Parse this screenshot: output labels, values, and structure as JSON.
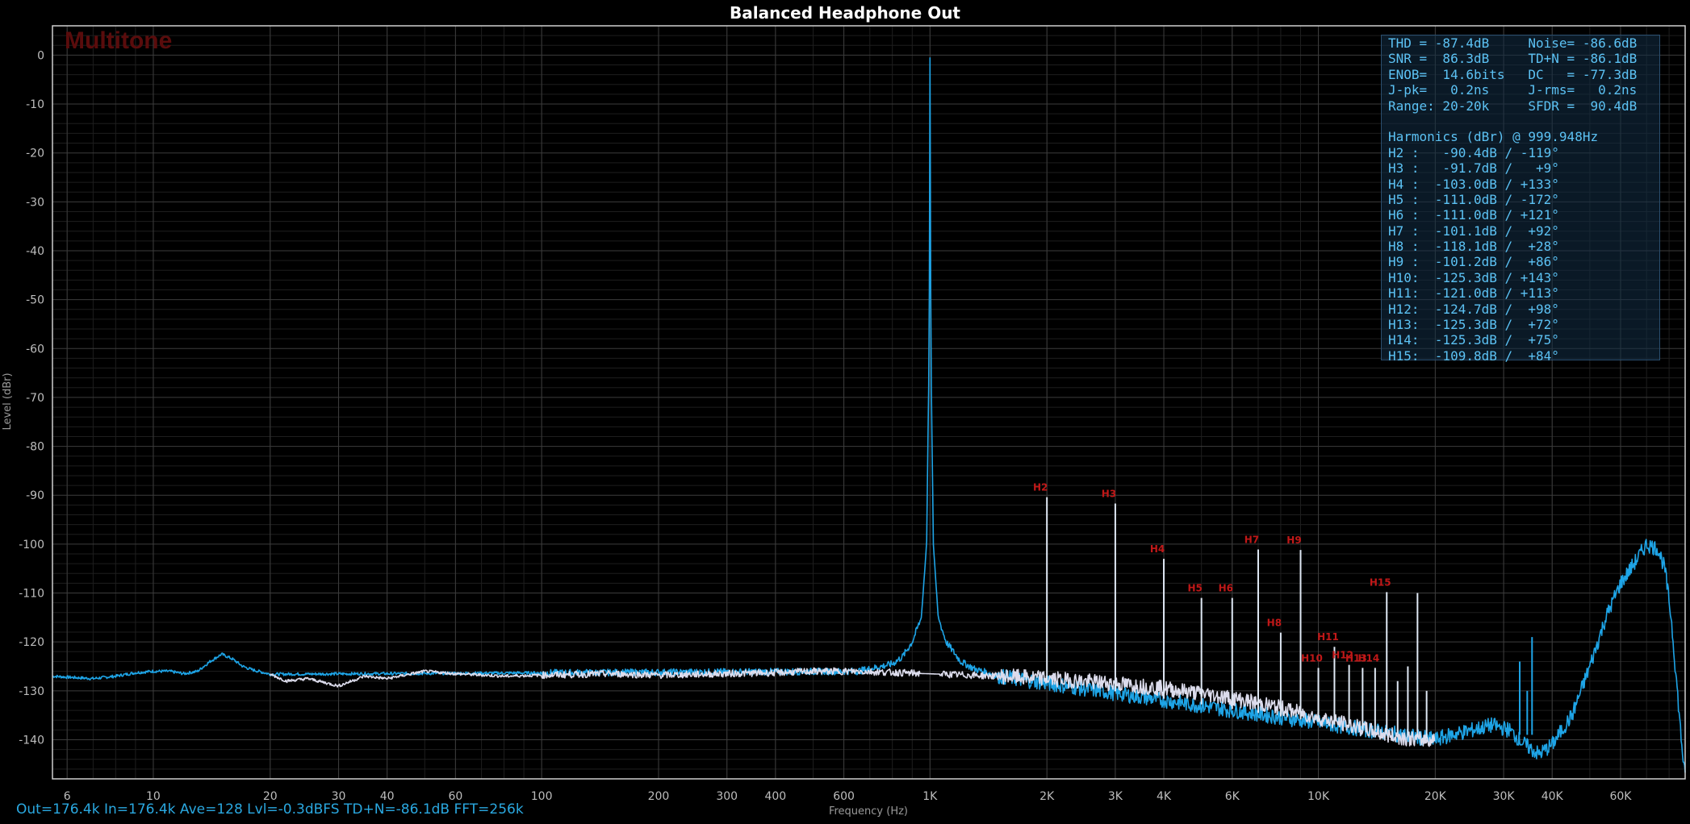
{
  "window": {
    "title": "Balanced Headphone Out"
  },
  "watermark": "Multitone",
  "footer": "Out=176.4k In=176.4k Ave=128 Lvl=-0.3dBFS TD+N=-86.1dB FFT=256k",
  "stats": {
    "summary": [
      "THD = -87.4dB     Noise= -86.6dB",
      "SNR =  86.3dB     TD+N = -86.1dB",
      "ENOB=  14.6bits   DC   = -77.3dB",
      "J-pk=   0.2ns     J-rms=   0.2ns",
      "Range: 20-20k     SFDR =  90.4dB"
    ],
    "harmonics_header": "Harmonics (dBr) @ 999.948Hz",
    "harmonics": [
      "H2 :   -90.4dB / -119°",
      "H3 :   -91.7dB /   +9°",
      "H4 :  -103.0dB / +133°",
      "H5 :  -111.0dB / -172°",
      "H6 :  -111.0dB / +121°",
      "H7 :  -101.1dB /  +92°",
      "H8 :  -118.1dB /  +28°",
      "H9 :  -101.2dB /  +86°",
      "H10:  -125.3dB / +143°",
      "H11:  -121.0dB / +113°",
      "H12:  -124.7dB /  +98°",
      "H13:  -125.3dB /  +72°",
      "H14:  -125.3dB /  +75°",
      "H15:  -109.8dB /  +84°"
    ]
  },
  "colors": {
    "background": "#000000",
    "grid": "#3c3c3c",
    "grid_minor": "#1e1e1e",
    "plot_border": "#cfcfcf",
    "spectrum_fundamental": "#1ea4e6",
    "spectrum_residual": "#dcdcec",
    "harmonic_label": "#c01818",
    "stats_text": "#5cc2f4",
    "footer_text": "#2aa8e0"
  },
  "chart_data": {
    "type": "line",
    "title": "Balanced Headphone Out",
    "xlabel": "Frequency (Hz)",
    "ylabel": "Level (dBr)",
    "xscale": "log",
    "xlim": [
      5.5,
      88000
    ],
    "ylim": [
      -148,
      6
    ],
    "grid": true,
    "x_ticks": [
      {
        "v": 6,
        "label": "6"
      },
      {
        "v": 10,
        "label": "10"
      },
      {
        "v": 20,
        "label": "20"
      },
      {
        "v": 30,
        "label": "30"
      },
      {
        "v": 40,
        "label": "40"
      },
      {
        "v": 60,
        "label": "60"
      },
      {
        "v": 100,
        "label": "100"
      },
      {
        "v": 200,
        "label": "200"
      },
      {
        "v": 300,
        "label": "300"
      },
      {
        "v": 400,
        "label": "400"
      },
      {
        "v": 600,
        "label": "600"
      },
      {
        "v": 1000,
        "label": "1K"
      },
      {
        "v": 2000,
        "label": "2K"
      },
      {
        "v": 3000,
        "label": "3K"
      },
      {
        "v": 4000,
        "label": "4K"
      },
      {
        "v": 6000,
        "label": "6K"
      },
      {
        "v": 10000,
        "label": "10K"
      },
      {
        "v": 20000,
        "label": "20K"
      },
      {
        "v": 30000,
        "label": "30K"
      },
      {
        "v": 40000,
        "label": "40K"
      },
      {
        "v": 60000,
        "label": "60K"
      }
    ],
    "y_ticks": [
      0,
      -10,
      -20,
      -30,
      -40,
      -50,
      -60,
      -70,
      -80,
      -90,
      -100,
      -110,
      -120,
      -130,
      -140
    ],
    "series": [
      {
        "color": "#1ea4e6",
        "points": [
          [
            5.5,
            -127
          ],
          [
            6,
            -127.2
          ],
          [
            7,
            -127.5
          ],
          [
            8,
            -127
          ],
          [
            9,
            -126.3
          ],
          [
            10,
            -126
          ],
          [
            11,
            -126
          ],
          [
            12,
            -126.5
          ],
          [
            13,
            -126
          ],
          [
            14,
            -124
          ],
          [
            15,
            -122.5
          ],
          [
            16,
            -123.5
          ],
          [
            17,
            -125
          ],
          [
            18,
            -125.7
          ],
          [
            20,
            -126.6
          ],
          [
            650,
            -126
          ],
          [
            700,
            -125.5
          ],
          [
            750,
            -125
          ],
          [
            800,
            -124.5
          ],
          [
            850,
            -123
          ],
          [
            900,
            -120
          ],
          [
            950,
            -115
          ],
          [
            980,
            -100
          ],
          [
            995,
            -60
          ],
          [
            1000,
            -0.3
          ],
          [
            1005,
            -60
          ],
          [
            1020,
            -100
          ],
          [
            1050,
            -115
          ],
          [
            1100,
            -120
          ],
          [
            1200,
            -124
          ],
          [
            1300,
            -125.5
          ],
          [
            1500,
            -127
          ],
          [
            20000,
            -140
          ],
          [
            22000,
            -139
          ],
          [
            25000,
            -138
          ],
          [
            28000,
            -137
          ],
          [
            31000,
            -138
          ],
          [
            34000,
            -141
          ],
          [
            37000,
            -143
          ],
          [
            40000,
            -141
          ],
          [
            45000,
            -135
          ],
          [
            50000,
            -125
          ],
          [
            55000,
            -115
          ],
          [
            60000,
            -108
          ],
          [
            65000,
            -104
          ],
          [
            70000,
            -100
          ],
          [
            75000,
            -101
          ],
          [
            78000,
            -105
          ],
          [
            81000,
            -115
          ],
          [
            84000,
            -130
          ],
          [
            86000,
            -140
          ],
          [
            88000,
            -148
          ]
        ]
      },
      {
        "color": "#dcdcec",
        "points": [
          [
            20,
            -126.6
          ],
          [
            22,
            -128
          ],
          [
            25,
            -127.5
          ],
          [
            30,
            -129
          ],
          [
            35,
            -127
          ],
          [
            40,
            -127.5
          ],
          [
            50,
            -126
          ],
          [
            60,
            -126.5
          ],
          [
            80,
            -127
          ],
          [
            100,
            -126.8
          ],
          [
            150,
            -126.5
          ],
          [
            200,
            -126.8
          ],
          [
            300,
            -126.5
          ],
          [
            400,
            -126.3
          ],
          [
            500,
            -126
          ],
          [
            650,
            -126
          ],
          [
            1500,
            -127
          ],
          [
            2000,
            -127.5
          ],
          [
            3000,
            -128.5
          ],
          [
            4000,
            -129.5
          ],
          [
            5000,
            -130.5
          ],
          [
            6000,
            -131.5
          ],
          [
            8000,
            -133.5
          ],
          [
            10000,
            -135.5
          ],
          [
            12000,
            -137
          ],
          [
            15000,
            -139
          ],
          [
            18000,
            -140
          ],
          [
            20000,
            -140
          ]
        ]
      }
    ],
    "harmonics": [
      {
        "label": "H2",
        "freq": 2000,
        "level": -90.4
      },
      {
        "label": "H3",
        "freq": 3000,
        "level": -91.7
      },
      {
        "label": "H4",
        "freq": 4000,
        "level": -103.0
      },
      {
        "label": "H5",
        "freq": 5000,
        "level": -111.0
      },
      {
        "label": "H6",
        "freq": 6000,
        "level": -111.0
      },
      {
        "label": "H7",
        "freq": 7000,
        "level": -101.1
      },
      {
        "label": "H8",
        "freq": 8000,
        "level": -118.1
      },
      {
        "label": "H9",
        "freq": 9000,
        "level": -101.2
      },
      {
        "label": "H10",
        "freq": 10000,
        "level": -125.3
      },
      {
        "label": "H11",
        "freq": 11000,
        "level": -121.0
      },
      {
        "label": "H12",
        "freq": 12000,
        "level": -124.7
      },
      {
        "label": "H13",
        "freq": 13000,
        "level": -125.3
      },
      {
        "label": "H14",
        "freq": 14000,
        "level": -125.3
      },
      {
        "label": "H15",
        "freq": 15000,
        "level": -109.8
      }
    ],
    "extra_spurs": [
      {
        "freq": 16000,
        "level": -128
      },
      {
        "freq": 17000,
        "level": -125
      },
      {
        "freq": 18000,
        "level": -110
      },
      {
        "freq": 19000,
        "level": -130
      },
      {
        "freq": 33000,
        "level": -124
      },
      {
        "freq": 34500,
        "level": -130
      },
      {
        "freq": 35500,
        "level": -119
      }
    ],
    "harmonic_spur_base": {
      "start": -128,
      "end": -140
    }
  }
}
